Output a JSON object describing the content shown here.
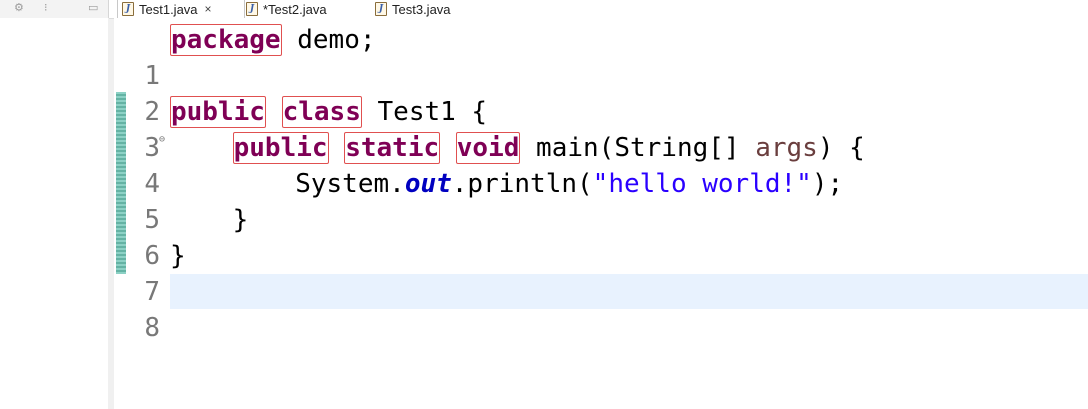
{
  "side_panel": {
    "toolbar_icons": [
      "gears-icon",
      "settings-icon",
      "window-icon"
    ]
  },
  "tabs": [
    {
      "label": "Test1.java",
      "active": true,
      "closable": true
    },
    {
      "label": "*Test2.java",
      "active": false,
      "closable": false
    },
    {
      "label": "Test3.java",
      "active": false,
      "closable": false
    }
  ],
  "tab_close_glyph": "×",
  "editor": {
    "line_numbers": [
      "1",
      "2",
      "3",
      "4",
      "5",
      "6",
      "7",
      "8"
    ],
    "lines": {
      "l1_kw": "package",
      "l1_rest": " demo;",
      "l3_kw1": "public",
      "l3_kw2": "class",
      "l3_rest": " Test1 {",
      "l4_indent": "    ",
      "l4_kw1": "public",
      "l4_kw2": "static",
      "l4_kw3": "void",
      "l4_mid": " main(String[] ",
      "l4_param": "args",
      "l4_end": ") {",
      "l5_indent": "        System.",
      "l5_field": "out",
      "l5_mid": ".println(",
      "l5_str": "\"hello world!\"",
      "l5_end": ");",
      "l6": "    }",
      "l7": "}"
    },
    "colors": {
      "keyword": "#7f0055",
      "string": "#2a00ff",
      "field": "#0000c0",
      "highlight_box": "#e05050",
      "current_line": "#e8f2fe"
    }
  }
}
